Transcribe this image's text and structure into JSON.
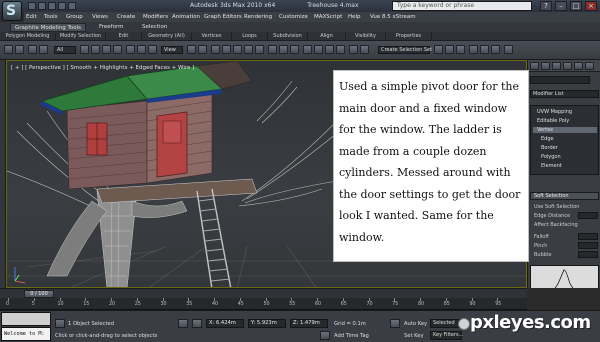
{
  "window": {
    "app_title": "Autodesk 3ds Max  2010 x64",
    "file_name": "Treehouse 4.max",
    "search_placeholder": "Type a keyword or phrase",
    "logo_glyph": "S"
  },
  "menu": [
    "Edit",
    "Tools",
    "Group",
    "Views",
    "Create",
    "Modifiers",
    "Animation",
    "Graph Editors",
    "Rendering",
    "Customize",
    "MAXScript",
    "Help",
    "Vue 8.5 xStream"
  ],
  "ribbon": {
    "tabs": [
      "Graphite Modeling Tools",
      "Freeform",
      "Selection"
    ],
    "panels": [
      "Polygon Modeling",
      "Modify Selection",
      "Edit",
      "Geometry (All)",
      "Vertices",
      "Loops",
      "Subdivision",
      "Align",
      "Visibility",
      "Properties"
    ]
  },
  "toolbar": {
    "selection_filter": "All",
    "view_dropdown": "View",
    "named_selection": "Create Selection Set"
  },
  "viewport": {
    "label": "[ + ] [ Perspective ] [ Smooth + Highlights + Edged Faces + Wire ]"
  },
  "caption": {
    "text": "Used a simple pivot door for the main door and a fixed window for the window. The ladder is made from a couple dozen cylinders. Messed around with the door settings to get the door look I wanted. Same for the window."
  },
  "command_panel": {
    "name_field": "",
    "modifier_list": "Modifier List",
    "stack_items": [
      "UVW Mapping",
      "Editable Poly",
      "Vertex",
      "Edge",
      "Border",
      "Polygon",
      "Element"
    ],
    "selected_item": "Vertex",
    "soft_selection": "Soft Selection",
    "use_soft": "Use Soft Selection",
    "edge_distance": "Edge Distance",
    "affect_backfacing": "Affect Backfacing",
    "falloff": "Falloff",
    "pinch": "Pinch",
    "bubble": "Bubble"
  },
  "timeline": {
    "frame_display": "0 / 100",
    "ticks": [
      "0",
      "5",
      "10",
      "15",
      "20",
      "25",
      "30",
      "35",
      "40",
      "45",
      "50",
      "55",
      "60",
      "65",
      "70",
      "75",
      "80",
      "85",
      "90",
      "95"
    ]
  },
  "status": {
    "listener": "Welcome to M:",
    "selection_info": "1 Object Selected",
    "prompt": "Click or click-and-drag to select objects",
    "x": "X: 6.424m",
    "y": "Y: 5.923m",
    "z": "Z: 1.479m",
    "grid": "Grid = 0.1m",
    "add_time_tag": "Add Time Tag",
    "auto_key": "Auto Key",
    "set_key": "Set Key",
    "key_mode": "Selected",
    "key_filters": "Key Filters..."
  },
  "watermark": "pxleyes.com"
}
